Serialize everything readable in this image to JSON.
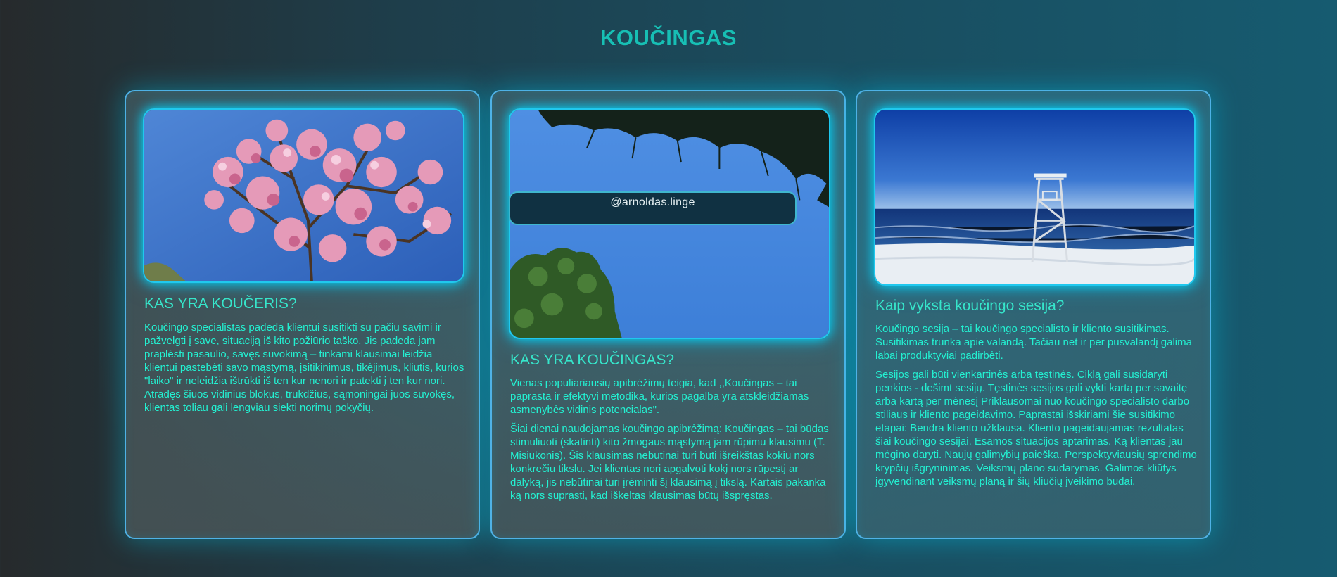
{
  "page_title": "KOUČINGAS",
  "cards": [
    {
      "title": "KAS YRA KOUČERIS?",
      "paragraphs": [
        "Koučingo specialistas padeda klientui susitikti su pačiu savimi ir pažvelgti į save, situaciją iš kito požiūrio taško. Jis padeda jam praplėsti pasaulio, savęs suvokimą – tinkami klausimai leidžia klientui pastebėti savo mąstymą, įsitikinimus, tikėjimus, kliūtis, kurios \"laiko\" ir neleidžia ištrūkti iš ten kur nenori ir patekti į ten kur nori. Atradęs šiuos vidinius blokus, trukdžius, sąmoningai juos suvokęs, klientas toliau gali lengviau siekti norimų pokyčių."
      ],
      "image": "pink-blossom-tree-sky"
    },
    {
      "title": "KAS YRA KOUČINGAS?",
      "paragraphs": [
        "Vienas populiariausių apibrėžimų teigia, kad ,,Koučingas – tai paprasta ir efektyvi metodika, kurios pagalba yra atskleidžiamas asmenybės vidinis potencialas\".",
        "Šiai dienai naudojamas koučingo apibrėžimą: Koučingas – tai būdas stimuliuoti (skatinti) kito žmogaus mąstymą jam rūpimu klausimu (T. Misiukonis). Šis klausimas nebūtinai turi būti išreikštas kokiu nors konkrečiu tikslu. Jei klientas nori apgalvoti kokį nors rūpestį ar dalyką, jis nebūtinai turi įrėminti šį klausimą į tikslą. Kartais pakanka ką nors suprasti, kad iškeltas klausimas būtų išspręstas."
      ],
      "image": "pine-branches-blue-sky",
      "image_overlay": "@arnoldas.linge"
    },
    {
      "title": "Kaip vyksta koučingo sesija?",
      "paragraphs": [
        "Koučingo sesija – tai koučingo specialisto ir kliento susitikimas. Susitikimas trunka apie valandą. Tačiau net ir per pusvalandį galima labai produktyviai padirbėti.",
        "Sesijos gali būti vienkartinės arba tęstinės. Ciklą gali susidaryti penkios - dešimt sesijų. Tęstinės sesijos gali vykti kartą per savaitę arba kartą per mėnesį Priklausomai nuo koučingo specialisto darbo stiliaus ir kliento pageidavimo. Paprastai išskiriami šie susitikimo etapai: Bendra kliento užklausa. Kliento pageidaujamas rezultatas šiai koučingo sesijai. Esamos situacijos aptarimas. Ką klientas jau mėgino daryti. Naujų galimybių paieška. Perspektyviausių sprendimo krypčių išgryninimas. Veiksmų plano sudarymas. Galimos kliūtys įgyvendinant veiksmų planą ir šių kliūčių įveikimo būdai."
      ],
      "image": "beach-lifeguard-tower-sea"
    }
  ],
  "colors": {
    "heading": "#17bfb4",
    "card_title": "#36e6cb",
    "card_text": "#23f1d2",
    "card_border": "#4fb2e6",
    "image_glow": "#20c8ee"
  }
}
